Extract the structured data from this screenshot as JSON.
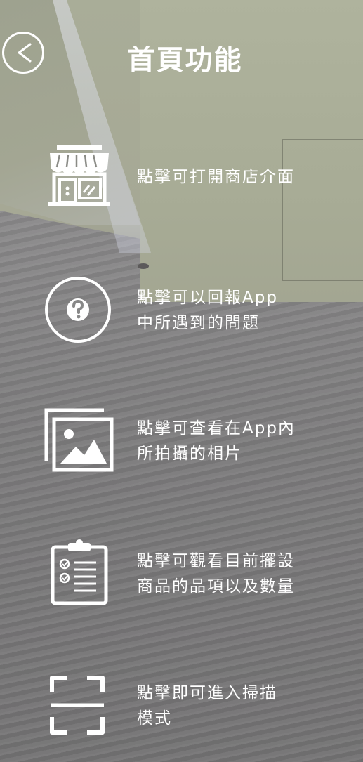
{
  "header": {
    "title": "首頁功能",
    "back_icon": "chevron-left-icon"
  },
  "features": [
    {
      "icon": "store-icon",
      "label": "點擊可打開商店介面"
    },
    {
      "icon": "question-circle-icon",
      "label": "點擊可以回報App\n中所遇到的問題"
    },
    {
      "icon": "gallery-icon",
      "label": "點擊可查看在App內\n所拍攝的相片"
    },
    {
      "icon": "clipboard-checklist-icon",
      "label": "點擊可觀看目前擺設\n商品的品項以及數量"
    },
    {
      "icon": "scan-frame-icon",
      "label": "點擊即可進入掃描\n模式"
    }
  ],
  "colors": {
    "foreground": "#ffffff"
  }
}
